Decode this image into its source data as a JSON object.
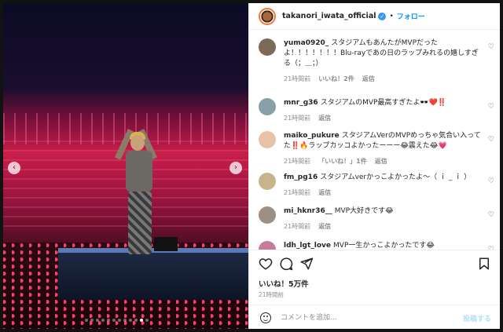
{
  "post": {
    "username": "takanori_iwata_official",
    "follow_label": "フォロー",
    "separator": "•",
    "likes": "いいね！5万件",
    "time": "21時間前",
    "comment_placeholder": "コメントを追加...",
    "post_label": "投稿する"
  },
  "media": {
    "prev_icon": "‹",
    "next_icon": "›",
    "carousel_dots": 12,
    "active_dot": 10
  },
  "comments": [
    {
      "user": "yuma0920_",
      "text": "スタジアムもあんたがMVPだったよ！！！！！！！Blu-rayであの日のラップみれるの嬉しすぎる（；＿；）",
      "time": "21時間前",
      "likes": "いいね！2件",
      "reply": "返信",
      "avatar_color": "#7a6a5a"
    },
    {
      "user": "mnr_g36",
      "text": "スタジアムのMVP最高すぎたよ🕶️❤️‼️",
      "time": "21時間前",
      "likes": "",
      "reply": "返信",
      "avatar_color": "#8aa0a8"
    },
    {
      "user": "maiko_pukure",
      "text": "スタジアムVerのMVPめっちゃ気合い入ってた‼️🔥ラップカッコよかったーーー😂震えた😂💗",
      "time": "21時間前",
      "likes": "「いいね！」1件",
      "reply": "返信",
      "avatar_color": "#e6c2a8"
    },
    {
      "user": "fm_pg16",
      "text": "スタジアムverかっこよかったよ〜（ ｉ _ ｉ ）",
      "time": "21時間前",
      "likes": "",
      "reply": "返信",
      "avatar_color": "#c9b48a"
    },
    {
      "user": "mi_hknr36__",
      "text": "MVP大好きです😂",
      "time": "21時間前",
      "likes": "",
      "reply": "返信",
      "avatar_color": "#9c8f86"
    },
    {
      "user": "ldh_lgt_love",
      "text": "MVP一生かっこよかったです😂",
      "time": "",
      "likes": "",
      "reply": "",
      "avatar_color": "#c77b9a"
    }
  ],
  "icons": {
    "heart": "heart-icon",
    "comment": "comment-icon",
    "share": "share-icon",
    "bookmark": "bookmark-icon",
    "emoji": "emoji-icon",
    "verified": "verified-badge-icon"
  }
}
